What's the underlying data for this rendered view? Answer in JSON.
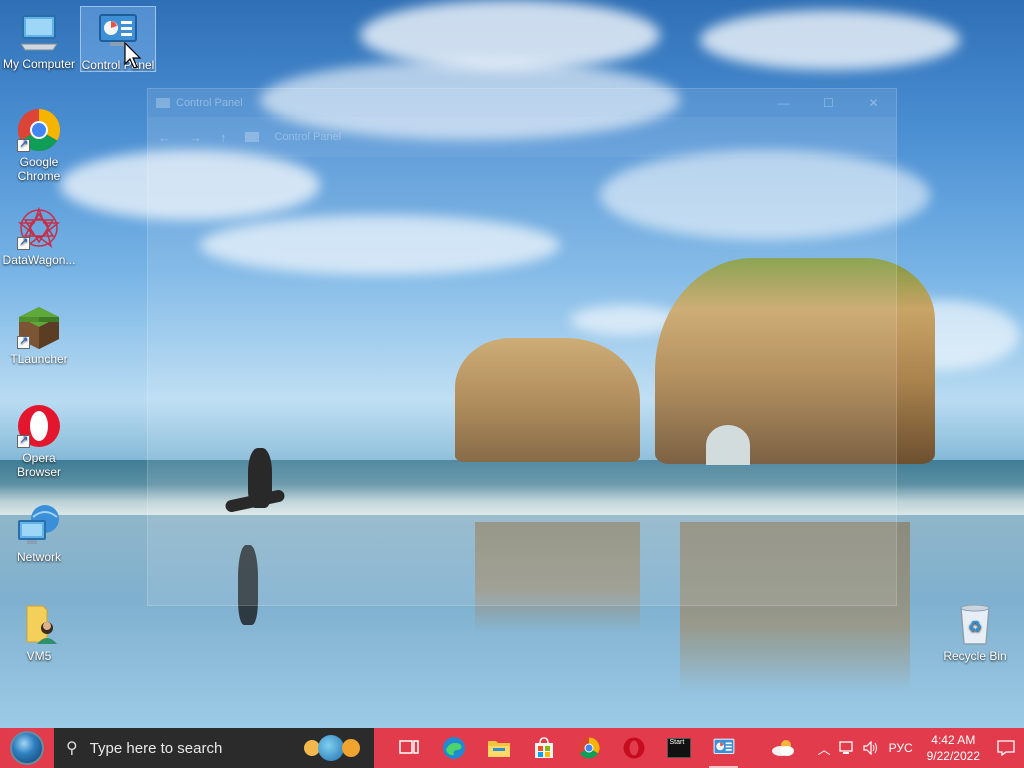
{
  "window": {
    "title": "Control Panel",
    "address": "Control Panel",
    "controls": {
      "minimize": "—",
      "maximize": "☐",
      "close": "✕"
    },
    "nav": {
      "back": "←",
      "forward": "→",
      "up": "↑"
    }
  },
  "desktop_icons": [
    {
      "label": "My Computer",
      "icon": "computer-icon"
    },
    {
      "label": "Control Panel",
      "icon": "control-panel-icon"
    },
    {
      "label": "Google Chrome",
      "icon": "chrome-icon"
    },
    {
      "label": "DataWagon...",
      "icon": "datawagon-icon"
    },
    {
      "label": "TLauncher",
      "icon": "tlauncher-icon"
    },
    {
      "label": "Opera Browser",
      "icon": "opera-icon"
    },
    {
      "label": "Network",
      "icon": "network-icon"
    },
    {
      "label": "VM5",
      "icon": "user-folder-icon"
    },
    {
      "label": "Recycle Bin",
      "icon": "recycle-bin-icon"
    }
  ],
  "taskbar": {
    "search_placeholder": "Type here to search",
    "apps": [
      {
        "name": "task-view-icon"
      },
      {
        "name": "edge-icon"
      },
      {
        "name": "file-explorer-icon"
      },
      {
        "name": "microsoft-store-icon"
      },
      {
        "name": "chrome-icon"
      },
      {
        "name": "opera-icon"
      },
      {
        "name": "start-app-icon",
        "label": "Start"
      },
      {
        "name": "control-panel-icon"
      }
    ],
    "tray": {
      "language": "РУС",
      "time": "4:42 AM",
      "date": "9/22/2022"
    }
  },
  "colors": {
    "taskbar": "#e23c4c",
    "search_box": "#2b2b2b"
  }
}
